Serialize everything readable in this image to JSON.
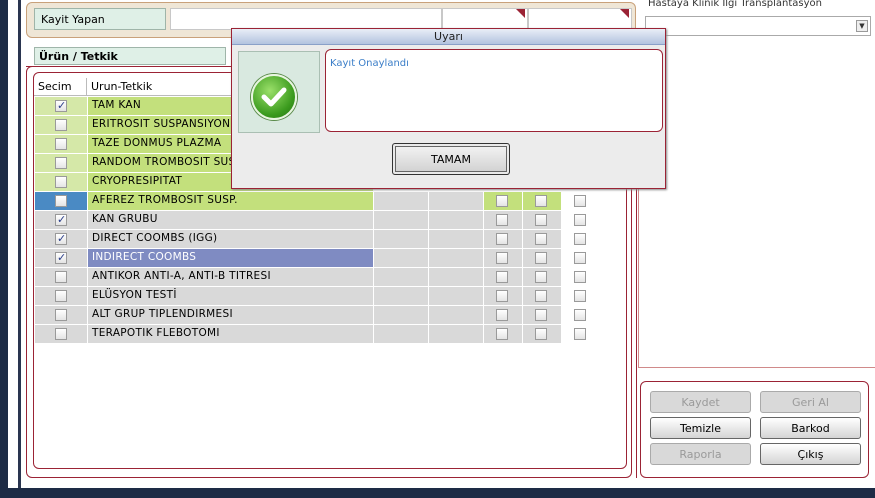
{
  "header": {
    "kayit_yapan_label": "Kayit Yapan"
  },
  "right_panel": {
    "top_text": "Hastaya Klinik İlgi Transplantasyon"
  },
  "urun_section": {
    "title": "Ürün / Tetkik",
    "columns": [
      "Secim",
      "Urun-Tetkik"
    ]
  },
  "rows": [
    {
      "name": "TAM KAN",
      "checked": true
    },
    {
      "name": "ERITROSIT SUSPANSIYONU",
      "checked": false
    },
    {
      "name": "TAZE DONMUS PLAZMA",
      "checked": false
    },
    {
      "name": "RANDOM TROMBOSIT SUSP.",
      "checked": false
    },
    {
      "name": "CRYOPRESIPITAT",
      "checked": false
    },
    {
      "name": "AFEREZ TROMBOSIT SUSP.",
      "checked": false
    },
    {
      "name": "KAN GRUBU",
      "checked": true
    },
    {
      "name": "DIRECT COOMBS (IGG)",
      "checked": true
    },
    {
      "name": "INDIRECT COOMBS",
      "checked": true
    },
    {
      "name": "ANTIKOR ANTI-A, ANTI-B TITRESI",
      "checked": false
    },
    {
      "name": "ELÜSYON TESTİ",
      "checked": false
    },
    {
      "name": "ALT GRUP TIPLENDIRMESI",
      "checked": false
    },
    {
      "name": "TERAPOTIK FLEBOTOMI",
      "checked": false
    }
  ],
  "dialog": {
    "title": "Uyarı",
    "message": "Kayıt Onaylandı",
    "ok_label": "TAMAM",
    "icon": "check-icon"
  },
  "actions": {
    "kaydet": "Kaydet",
    "geri_al": "Geri Al",
    "temizle": "Temizle",
    "barkod": "Barkod",
    "raporla": "Raporla",
    "cikis": "Çıkış"
  },
  "colors": {
    "accent_border": "#9b2335",
    "row_green": "#c3e07c",
    "row_blue_selected": "#7f8bc2",
    "message_text": "#3b7ec8"
  }
}
